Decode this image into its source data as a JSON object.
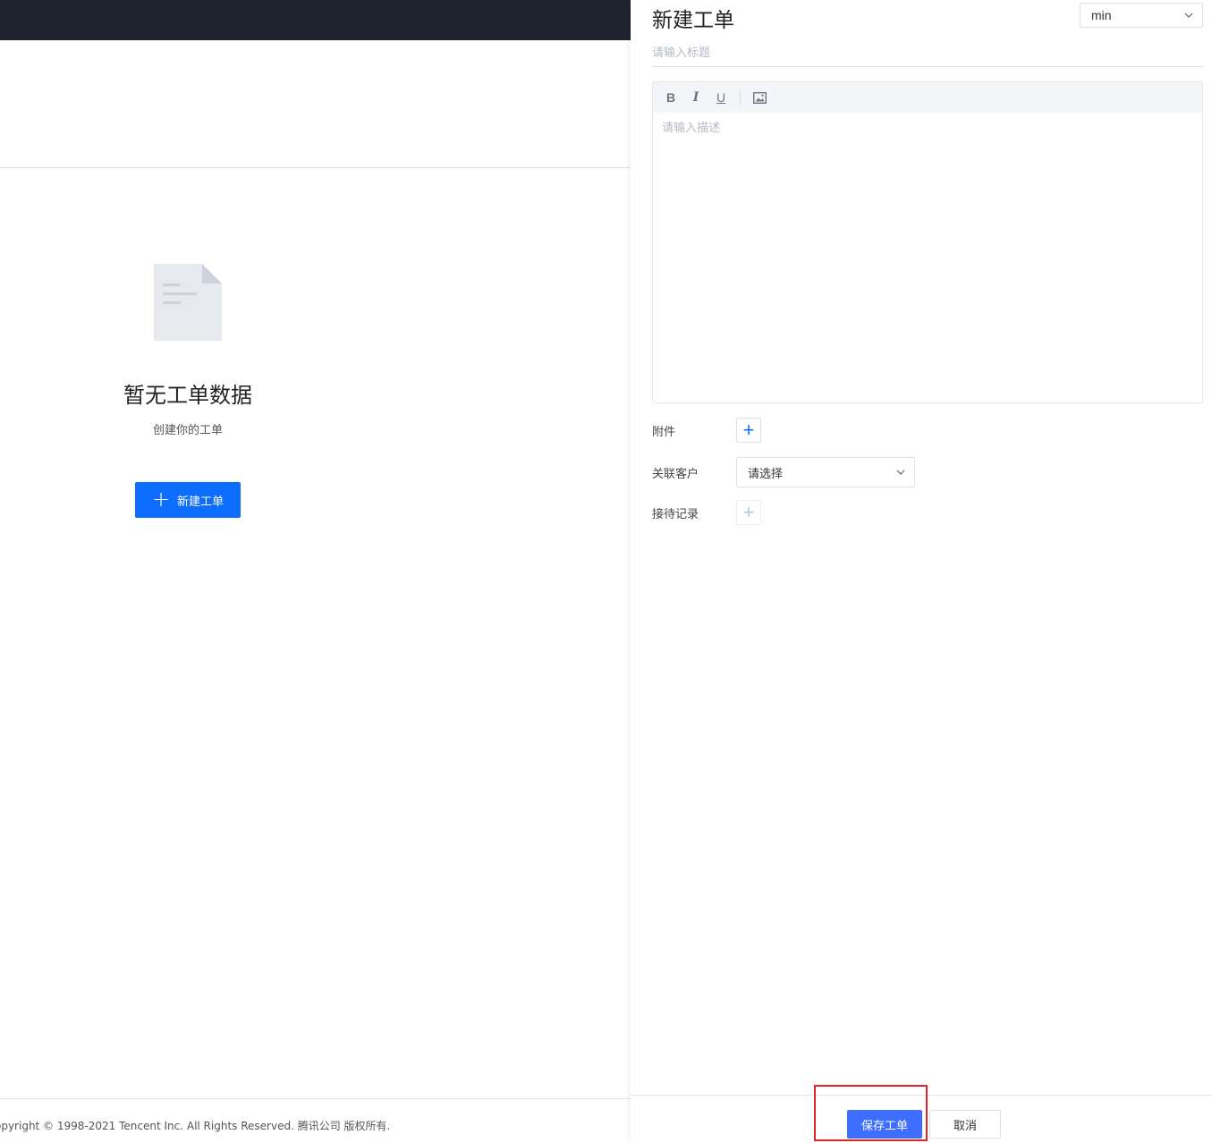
{
  "left_page": {
    "empty_state": {
      "icon": "document-icon",
      "title": "暂无工单数据",
      "subtitle": "创建你的工单",
      "create_button": {
        "icon": "plus-icon",
        "label": "新建工单"
      }
    },
    "footer": {
      "copyright": "opyright © 1998-2021 Tencent Inc. All Rights Reserved. 腾讯公司 版权所有."
    },
    "colors": {
      "nav_bg": "#1f2430",
      "primary": "#0d6dff"
    }
  },
  "drawer": {
    "title": "新建工单",
    "type_select": {
      "value": "min",
      "icon": "chevron-down-icon"
    },
    "title_input": {
      "value": "",
      "placeholder": "请输入标题"
    },
    "editor": {
      "toolbar": [
        {
          "name": "bold",
          "glyph": "B"
        },
        {
          "name": "italic",
          "glyph": "I"
        },
        {
          "name": "underline",
          "glyph": "U"
        },
        {
          "name": "image",
          "icon": "image-icon"
        }
      ],
      "value": "",
      "placeholder": "请输入描述"
    },
    "fields": {
      "attachment": {
        "label": "附件",
        "icon": "plus-icon"
      },
      "customer": {
        "label": "关联客户",
        "value": "请选择",
        "icon": "chevron-down-icon"
      },
      "reception": {
        "label": "接待记录",
        "icon": "plus-icon"
      }
    },
    "footer": {
      "save_label": "保存工单",
      "cancel_label": "取消"
    },
    "colors": {
      "save_bg": "#3d6eff",
      "highlight": "#e0262c"
    }
  }
}
